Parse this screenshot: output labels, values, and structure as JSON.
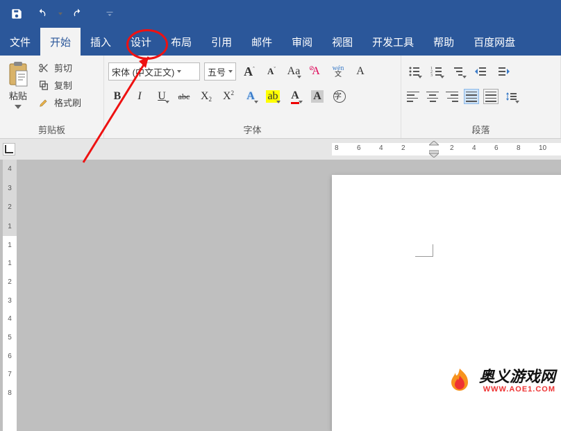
{
  "titlebar": {
    "save_icon": "save",
    "undo_icon": "undo",
    "redo_icon": "redo",
    "customize_icon": "customize"
  },
  "tabs": {
    "file": "文件",
    "home": "开始",
    "insert": "插入",
    "design": "设计",
    "layout": "布局",
    "references": "引用",
    "mailings": "邮件",
    "review": "审阅",
    "view": "视图",
    "developer": "开发工具",
    "help": "帮助",
    "baidu": "百度网盘",
    "active": "home",
    "circled": "design"
  },
  "clipboard": {
    "group_label": "剪贴板",
    "paste_label": "粘贴",
    "cut_label": "剪切",
    "copy_label": "复制",
    "format_painter_label": "格式刷"
  },
  "font": {
    "group_label": "字体",
    "name": "宋体 (中文正文)",
    "size": "五号",
    "grow": "A",
    "shrink": "A",
    "changecase": "Aa",
    "clear_a": "A",
    "phonetic_top": "wén",
    "phonetic_bot": "文",
    "charborder": "A",
    "bold": "B",
    "italic": "I",
    "underline": "U",
    "strike": "abc",
    "sub_base": "X",
    "sub_s": "2",
    "sup_base": "X",
    "sup_s": "2",
    "texteffects": "A",
    "highlight": "ab",
    "fontcolor": "A",
    "charshade": "A",
    "enclose": "字"
  },
  "paragraph": {
    "group_label": "段落"
  },
  "ruler": {
    "h_values": [
      "8",
      "6",
      "4",
      "2",
      "",
      "2",
      "4",
      "6",
      "8",
      "10"
    ]
  },
  "vruler_values": [
    "4",
    "3",
    "2",
    "1",
    "",
    "1",
    "1",
    "2",
    "3",
    "4",
    "5",
    "6",
    "7",
    "8"
  ],
  "watermark": {
    "line1": "奥义游戏网",
    "line2": "WWW.AOE1.COM"
  },
  "annotation": {
    "type": "red-circle-highlight",
    "target_tab": "design"
  }
}
